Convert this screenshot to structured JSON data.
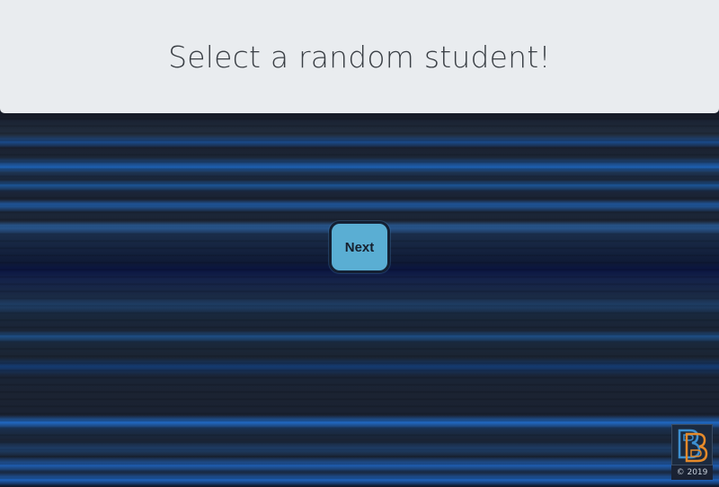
{
  "header": {
    "title": "Select a random student!"
  },
  "controls": {
    "next_label": "Next"
  },
  "footer": {
    "logo_icon": "bb-monogram-logo-icon",
    "copyright": "© 2019"
  },
  "colors": {
    "header_bg": "#e9ecef",
    "button_bg": "#5aaed3",
    "background": "#171c28",
    "logo_blue": "#3d8fd0",
    "logo_orange": "#e58a2a"
  }
}
